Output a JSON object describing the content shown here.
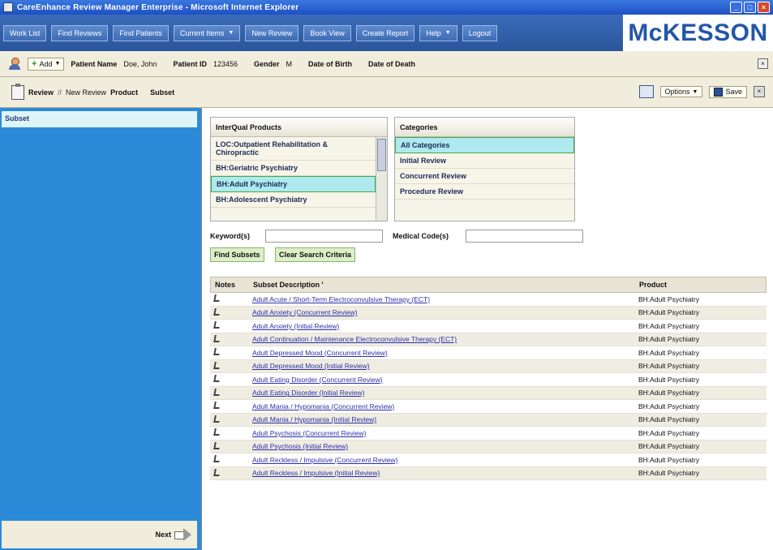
{
  "window": {
    "title": "CareEnhance Review Manager Enterprise - Microsoft Internet Explorer",
    "controls": [
      "_",
      "□",
      "×"
    ]
  },
  "nav": {
    "items": [
      {
        "label": "Work List",
        "dropdown": false
      },
      {
        "label": "Find Reviews",
        "dropdown": false
      },
      {
        "label": "Find Patients",
        "dropdown": false
      },
      {
        "label": "Current Items",
        "dropdown": true
      },
      {
        "label": "New Review",
        "dropdown": false
      },
      {
        "label": "Book View",
        "dropdown": false
      },
      {
        "label": "Create Report",
        "dropdown": false
      },
      {
        "label": "Help",
        "dropdown": true
      },
      {
        "label": "Logout",
        "dropdown": false
      }
    ],
    "logo": "McKESSON"
  },
  "patient": {
    "add_label": "Add",
    "name_label": "Patient Name",
    "name_value": "Doe, John",
    "id_label": "Patient ID",
    "id_value": "123456",
    "gender_label": "Gender",
    "gender_value": "M",
    "dob_label": "Date of Birth",
    "dod_label": "Date of Death"
  },
  "breadcrumb": {
    "review": "Review",
    "sep": "//",
    "new_review": "New Review",
    "product": "Product",
    "subset": "Subset"
  },
  "toolbar": {
    "options_label": "Options",
    "save_label": "Save"
  },
  "sidebar": {
    "selected_item": "Subset",
    "next_label": "Next"
  },
  "products": {
    "header": "InterQual Products",
    "items": [
      "LOC:Outpatient Rehabilitation & Chiropractic",
      "BH:Geriatric Psychiatry",
      "BH:Adult Psychiatry",
      "BH:Adolescent Psychiatry"
    ],
    "selected_index": 2
  },
  "categories": {
    "header": "Categories",
    "items": [
      "All Categories",
      "Initial Review",
      "Concurrent Review",
      "Procedure Review"
    ],
    "selected_index": 0
  },
  "search": {
    "keywords_label": "Keyword(s)",
    "keywords_value": "",
    "codes_label": "Medical Code(s)",
    "codes_value": "",
    "find_label": "Find Subsets",
    "clear_label": "Clear Search Criteria"
  },
  "results": {
    "headers": {
      "notes": "Notes",
      "description": "Subset Description",
      "sort_marker": "'",
      "product": "Product"
    },
    "rows": [
      {
        "description": "Adult Acute / Short-Term Electroconvulsive Therapy (ECT)",
        "product": "BH:Adult Psychiatry"
      },
      {
        "description": "Adult Anxiety (Concurrent Review)",
        "product": "BH:Adult Psychiatry"
      },
      {
        "description": "Adult Anxiety (Initial Review)",
        "product": "BH:Adult Psychiatry"
      },
      {
        "description": "Adult Continuation / Maintenance Electroconvulsive Therapy (ECT)",
        "product": "BH:Adult Psychiatry"
      },
      {
        "description": "Adult Depressed Mood (Concurrent Review)",
        "product": "BH:Adult Psychiatry"
      },
      {
        "description": "Adult Depressed Mood (Initial Review)",
        "product": "BH:Adult Psychiatry"
      },
      {
        "description": "Adult Eating Disorder (Concurrent Review)",
        "product": "BH:Adult Psychiatry"
      },
      {
        "description": "Adult Eating Disorder (Initial Review)",
        "product": "BH:Adult Psychiatry"
      },
      {
        "description": "Adult Mania / Hypomania (Concurrent Review)",
        "product": "BH:Adult Psychiatry"
      },
      {
        "description": "Adult Mania / Hypomania (Initial Review)",
        "product": "BH:Adult Psychiatry"
      },
      {
        "description": "Adult Psychosis (Concurrent Review)",
        "product": "BH:Adult Psychiatry"
      },
      {
        "description": "Adult Psychosis (Initial Review)",
        "product": "BH:Adult Psychiatry"
      },
      {
        "description": "Adult Reckless / Impulsive (Concurrent Review)",
        "product": "BH:Adult Psychiatry"
      },
      {
        "description": "Adult Reckless / Impulsive (Initial Review)",
        "product": "BH:Adult Psychiatry"
      }
    ]
  }
}
